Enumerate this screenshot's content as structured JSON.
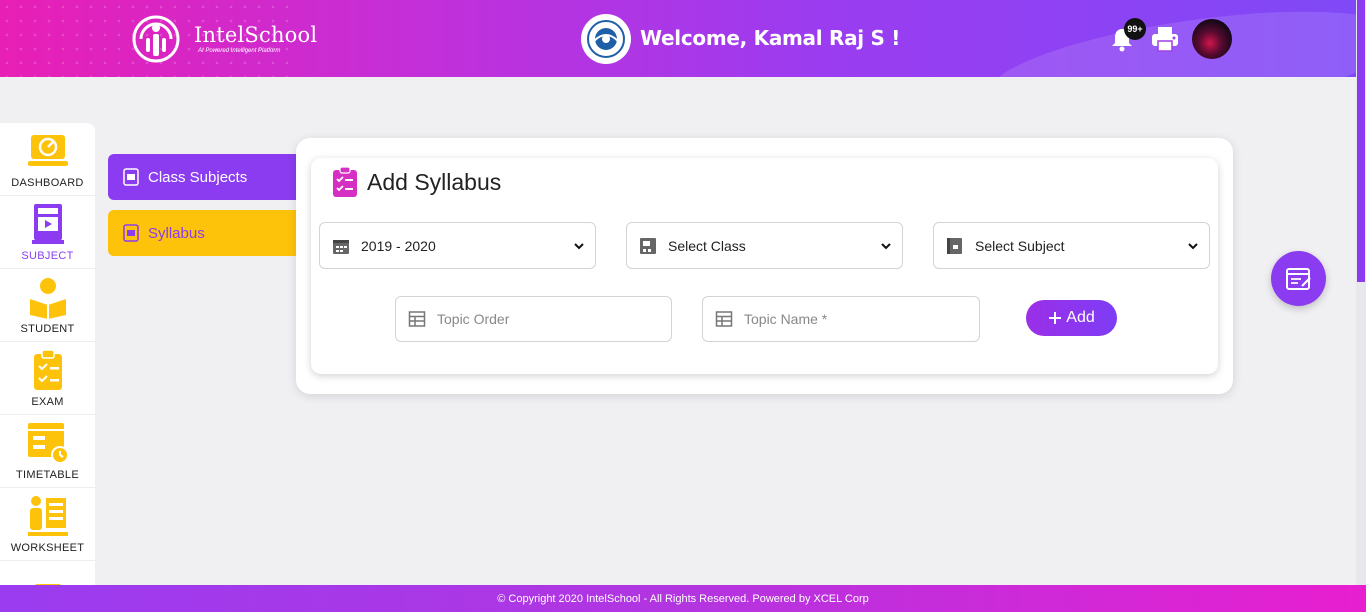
{
  "header": {
    "logo_name": "IntelSchool",
    "logo_tagline": "AI Powered Intelligent Platform",
    "welcome": "Welcome, Kamal Raj S !",
    "notification_count": "99+"
  },
  "sidebar": {
    "items": [
      {
        "label": "DASHBOARD",
        "icon": "dashboard-icon"
      },
      {
        "label": "SUBJECT",
        "icon": "subject-icon",
        "active": true
      },
      {
        "label": "STUDENT",
        "icon": "student-icon"
      },
      {
        "label": "EXAM",
        "icon": "exam-icon"
      },
      {
        "label": "TIMETABLE",
        "icon": "timetable-icon"
      },
      {
        "label": "WORKSHEET",
        "icon": "worksheet-icon"
      }
    ]
  },
  "submenu": {
    "items": [
      {
        "label": "Class Subjects"
      },
      {
        "label": "Syllabus",
        "active": true
      }
    ]
  },
  "form": {
    "title": "Add Syllabus",
    "year_select": "2019 - 2020",
    "class_select": "Select Class",
    "subject_select": "Select Subject",
    "topic_order_placeholder": "Topic Order",
    "topic_name_placeholder": "Topic Name *",
    "add_label": "Add"
  },
  "footer": {
    "text": "© Copyright 2020 IntelSchool - All Rights Reserved. Powered by XCEL Corp"
  },
  "colors": {
    "accent": "#8b3cf0",
    "highlight": "#fdc30a",
    "header_pink": "#e81fb5"
  }
}
